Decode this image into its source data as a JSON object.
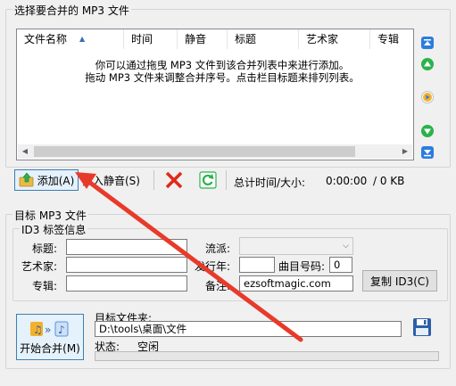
{
  "source_group": {
    "title": "选择要合并的 MP3 文件",
    "columns": [
      "文件名称",
      "时间",
      "静音",
      "标题",
      "艺术家",
      "专辑"
    ],
    "sort_indicator": "▲",
    "hint_line1": "你可以通过拖曳 MP3 文件到该合并列表中来进行添加。",
    "hint_line2": "拖动 MP3 文件来调整合并序号。点击栏目标题来排列列表。"
  },
  "side_buttons": [
    "move-top",
    "move-up",
    "play",
    "move-down",
    "move-bottom"
  ],
  "toolbar": {
    "add_label": "添加(A)",
    "insert_silence_label": "插入静音(S)",
    "total_label": "总计时间/大小:",
    "total_time": "0:00:00",
    "total_size": "/ 0 KB"
  },
  "target_group": {
    "title": "目标 MP3 文件",
    "id3_title": "ID3 标签信息",
    "labels": {
      "title": "标题:",
      "artist": "艺术家:",
      "album": "专辑:",
      "genre": "流派:",
      "year": "发行年:",
      "track": "曲目号码:",
      "comment": "备注:"
    },
    "values": {
      "title": "",
      "artist": "",
      "album": "",
      "genre": "",
      "year": "",
      "track": "0",
      "comment": "ezsoftmagic.com"
    },
    "copy_id3_label": "复制 ID3(C)",
    "start_label": "开始合并(M)",
    "folder_label": "目标文件夹:",
    "folder_value": "D:\\tools\\桌面\\文件",
    "status_label": "状态:",
    "status_value": "空闲"
  },
  "colors": {
    "arrow": "#e83a2a",
    "highlight": "#3c7fb1",
    "green": "#2bb24c",
    "blue": "#2c7ce0"
  }
}
